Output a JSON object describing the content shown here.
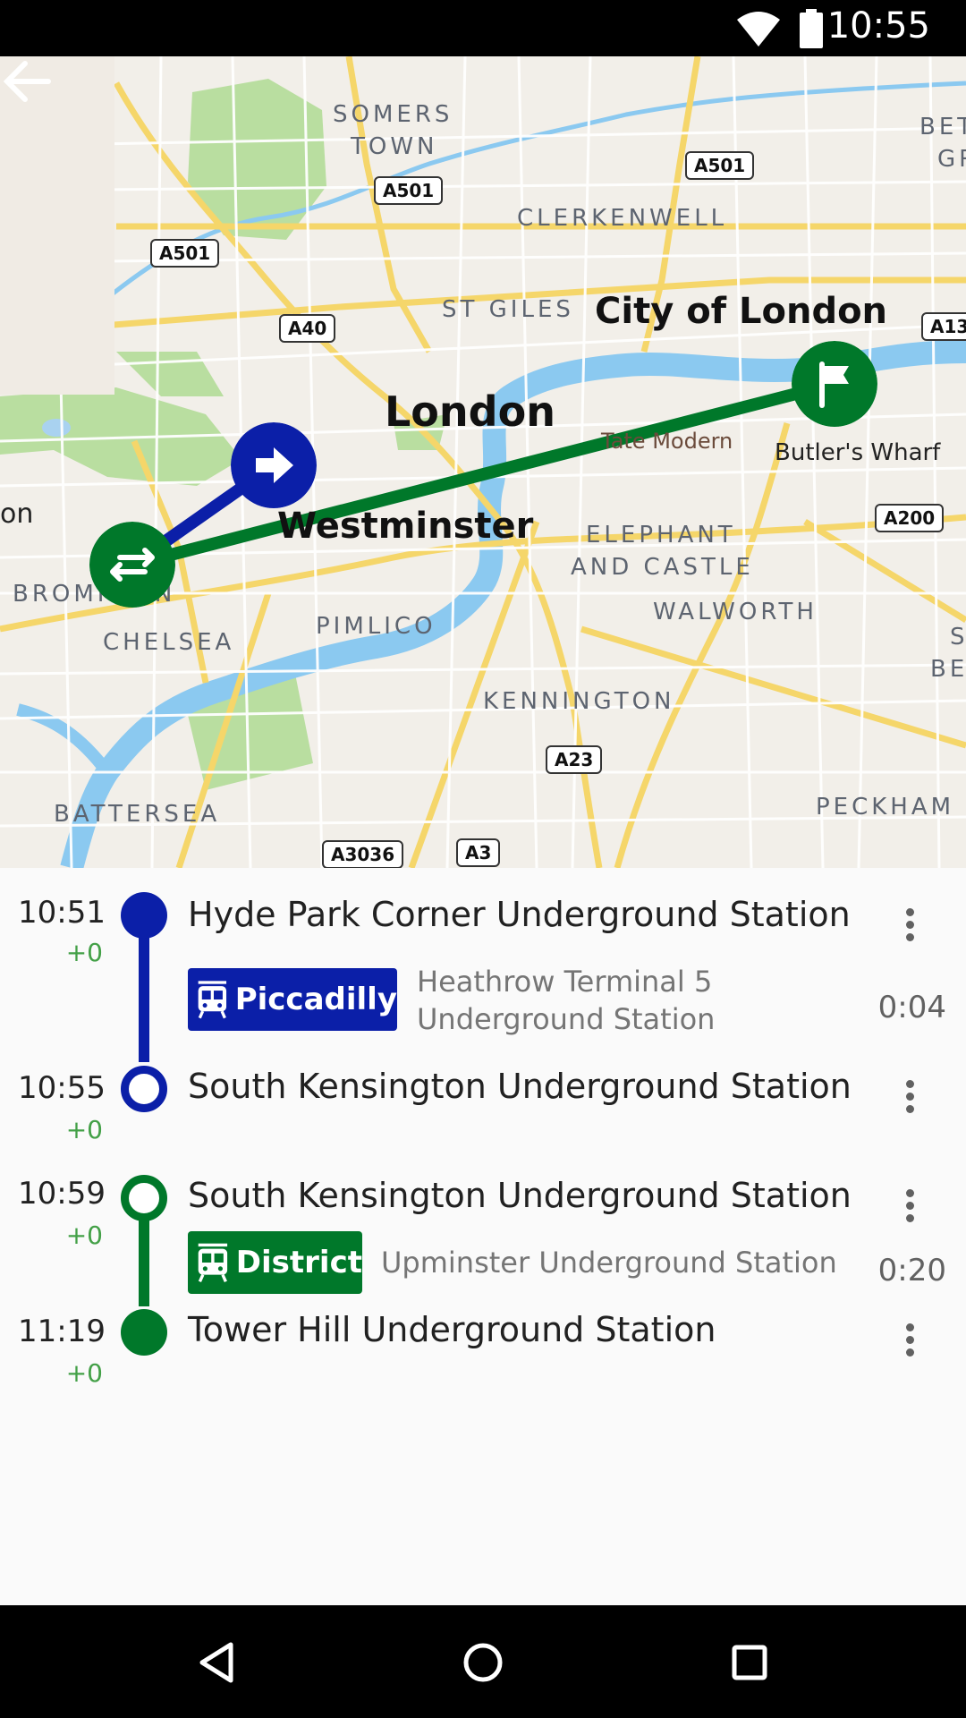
{
  "status_bar": {
    "time": "10:55"
  },
  "map": {
    "labels": {
      "somers": "SOMERS",
      "town": "TOWN",
      "clerkenwell": "CLERKENWELL",
      "st_giles": "ST GILES",
      "city_of_london": "City of London",
      "london": "London",
      "westminster": "Westminster",
      "tate_modern": "Tate Modern",
      "butlers_wharf": "Butler's Wharf",
      "elephant": "ELEPHANT",
      "and_castle": "AND CASTLE",
      "walworth": "WALWORTH",
      "pimlico": "PIMLICO",
      "chelsea": "CHELSEA",
      "brompton": "BROMPTON",
      "kennington": "KENNINGTON",
      "battersea": "BATTERSEA",
      "peckham": "PECKHAM",
      "bet": "BET",
      "gr": "GR",
      "bern": "BERN",
      "s": "S",
      "on": "on"
    },
    "road_shields": {
      "a501_1": "A501",
      "a501_2": "A501",
      "a501_3": "A501",
      "a40": "A40",
      "a13": "A13",
      "a200": "A200",
      "a23": "A23",
      "a3036": "A3036",
      "a3": "A3"
    },
    "colors": {
      "piccadilly": "#0b1fa8",
      "district": "#00782a"
    }
  },
  "trip": {
    "legs": [
      {
        "line": "Piccadilly",
        "headsign": [
          "Heathrow Terminal 5",
          "Underground Station"
        ],
        "duration": "0:04",
        "from": {
          "time": "10:51",
          "delay": "+0",
          "name": "Hyde Park Corner Underground Station"
        },
        "to": {
          "time": "10:55",
          "delay": "+0",
          "name": "South Kensington Underground Station"
        }
      },
      {
        "line": "District",
        "headsign": [
          "Upminster Underground Station"
        ],
        "duration": "0:20",
        "from": {
          "time": "10:59",
          "delay": "+0",
          "name": "South Kensington Underground Station"
        },
        "to": {
          "time": "11:19",
          "delay": "+0",
          "name": "Tower Hill Underground Station"
        }
      }
    ]
  }
}
